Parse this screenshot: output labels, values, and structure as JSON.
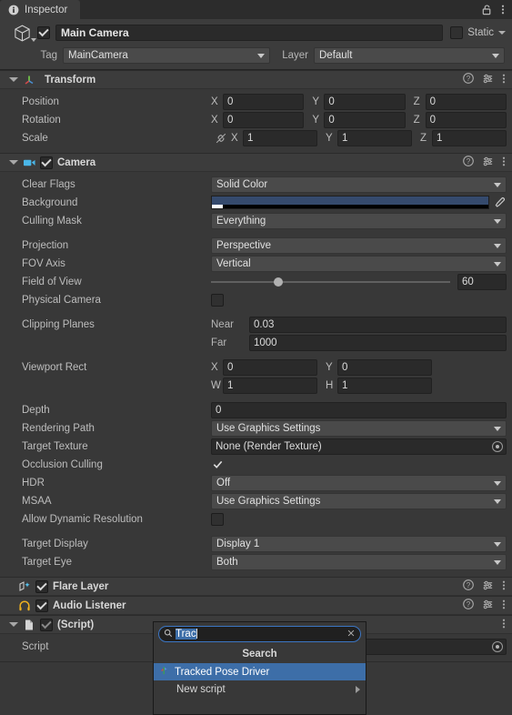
{
  "window": {
    "tab_label": "Inspector",
    "tab_icon": "info-icon",
    "lock_icon": "lock-open-icon",
    "menu_icon": "kebab-menu-icon"
  },
  "gameobject": {
    "icon": "cube-icon",
    "enabled": true,
    "name": "Main Camera",
    "static_label": "Static",
    "static_checked": false,
    "tag_label": "Tag",
    "tag_value": "MainCamera",
    "layer_label": "Layer",
    "layer_value": "Default"
  },
  "components": [
    {
      "title": "Transform",
      "icon": "transform-axis-icon",
      "has_enable_checkbox": false,
      "rows": [
        {
          "label": "Position",
          "type": "vector3",
          "x": "0",
          "y": "0",
          "z": "0"
        },
        {
          "label": "Rotation",
          "type": "vector3",
          "x": "0",
          "y": "0",
          "z": "0"
        },
        {
          "label": "Scale",
          "type": "vector3_link",
          "link_icon": "constrain-proportions-off-icon",
          "x": "1",
          "y": "1",
          "z": "1"
        }
      ]
    },
    {
      "title": "Camera",
      "icon": "camera-icon",
      "has_enable_checkbox": true,
      "enabled": true,
      "rows": [
        {
          "label": "Clear Flags",
          "type": "dropdown",
          "value": "Solid Color"
        },
        {
          "label": "Background",
          "type": "color",
          "color": "#354a6d",
          "eyedropper_icon": "eyedropper-icon"
        },
        {
          "label": "Culling Mask",
          "type": "dropdown",
          "value": "Everything"
        },
        {
          "type": "spacer"
        },
        {
          "label": "Projection",
          "type": "dropdown",
          "value": "Perspective"
        },
        {
          "label": "FOV Axis",
          "type": "dropdown",
          "value": "Vertical"
        },
        {
          "label": "Field of View",
          "type": "slider",
          "value": "60",
          "fill_percent": 28
        },
        {
          "label": "Physical Camera",
          "type": "checkbox",
          "checked": false
        },
        {
          "type": "spacer"
        },
        {
          "label": "Clipping Planes",
          "type": "pair",
          "sub1": "Near",
          "val1": "0.03",
          "sub2": "Far",
          "val2": "1000"
        },
        {
          "type": "spacer"
        },
        {
          "label": "Viewport Rect",
          "type": "rect",
          "x_label": "X",
          "x": "0",
          "y_label": "Y",
          "y": "0",
          "w_label": "W",
          "w": "1",
          "h_label": "H",
          "h": "1"
        },
        {
          "type": "spacer"
        },
        {
          "label": "Depth",
          "type": "text",
          "value": "0"
        },
        {
          "label": "Rendering Path",
          "type": "dropdown",
          "value": "Use Graphics Settings"
        },
        {
          "label": "Target Texture",
          "type": "object",
          "value": "None (Render Texture)"
        },
        {
          "label": "Occlusion Culling",
          "type": "checkbox",
          "checked": true
        },
        {
          "label": "HDR",
          "type": "dropdown",
          "value": "Off"
        },
        {
          "label": "MSAA",
          "type": "dropdown",
          "value": "Use Graphics Settings"
        },
        {
          "label": "Allow Dynamic Resolution",
          "type": "checkbox",
          "checked": false
        },
        {
          "type": "spacer"
        },
        {
          "label": "Target Display",
          "type": "dropdown",
          "value": "Display 1"
        },
        {
          "label": "Target Eye",
          "type": "dropdown",
          "value": "Both"
        }
      ]
    },
    {
      "title": "Flare Layer",
      "icon": "flare-layer-icon",
      "has_enable_checkbox": true,
      "enabled": true,
      "collapsed": true,
      "rows": []
    },
    {
      "title": "Audio Listener",
      "icon": "headphones-icon",
      "has_enable_checkbox": true,
      "enabled": true,
      "collapsed": true,
      "rows": []
    },
    {
      "title": "(Script)",
      "icon": "script-document-icon",
      "has_enable_checkbox": true,
      "enabled": true,
      "rows": [
        {
          "label": "Script",
          "type": "object",
          "value": ""
        }
      ]
    }
  ],
  "header_icons": {
    "help": "help-icon",
    "preset": "preset-sliders-icon",
    "menu": "kebab-menu-icon"
  },
  "search_popup": {
    "search_icon": "magnifier-icon",
    "clear_icon": "clear-x-icon",
    "query": "Trac",
    "query_selected": true,
    "section_title": "Search",
    "items": [
      {
        "label": "Tracked Pose Driver",
        "icon": "script-asset-icon",
        "selected": true,
        "has_submenu": false
      },
      {
        "label": "New script",
        "icon": "",
        "selected": false,
        "has_submenu": true
      }
    ]
  },
  "colors": {
    "panel_bg": "#383838",
    "header_bg": "#3c3c3c",
    "field_bg": "#2a2a2a",
    "dropdown_bg": "#4a4a4a",
    "accent_blue": "#3d6ea8",
    "background_color_value": "#354a6d"
  }
}
